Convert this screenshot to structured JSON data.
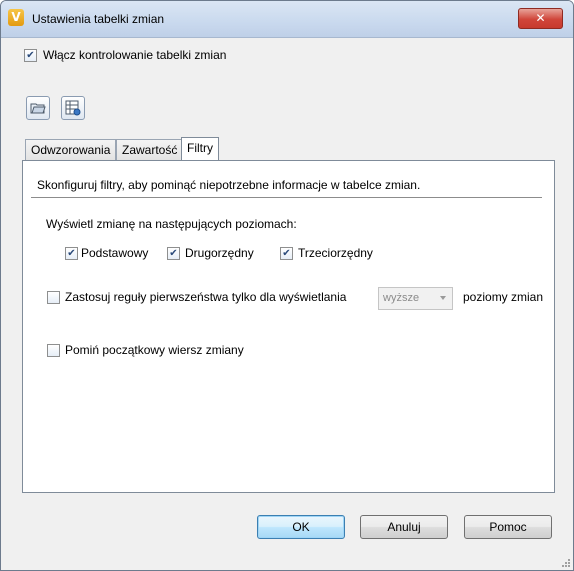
{
  "window": {
    "title": "Ustawienia tabelki zmian",
    "close_label": "✕",
    "app_icon_letter": "V"
  },
  "enable_control": {
    "label": "Włącz kontrolowanie tabelki zmian",
    "checked": true
  },
  "toolbar": {
    "icons": [
      "open-folder-icon",
      "table-settings-icon"
    ]
  },
  "tabs": [
    {
      "label": "Odwzorowania",
      "active": false
    },
    {
      "label": "Zawartość",
      "active": false
    },
    {
      "label": "Filtry",
      "active": true
    }
  ],
  "filters": {
    "description": "Skonfiguruj filtry, aby pominąć niepotrzebne informacje w tabelce zmian.",
    "levels_heading": "Wyświetl zmianę na następujących poziomach:",
    "levels": [
      {
        "label": "Podstawowy",
        "checked": true
      },
      {
        "label": "Drugorzędny",
        "checked": true
      },
      {
        "label": "Trzeciorzędny",
        "checked": true
      }
    ],
    "precedence_label": "Zastosuj reguły pierwszeństwa tylko dla wyświetlania",
    "precedence_checked": false,
    "precedence_select_value": "wyższe",
    "precedence_suffix": "poziomy zmian",
    "skip_initial_label": "Pomiń początkowy wiersz zmiany",
    "skip_initial_checked": false
  },
  "buttons": {
    "ok": "OK",
    "cancel": "Anuluj",
    "help": "Pomoc"
  },
  "colors": {
    "close_button": "#d0453a",
    "title_bar": "#c9d9ee",
    "app_icon": "#e39a10"
  }
}
